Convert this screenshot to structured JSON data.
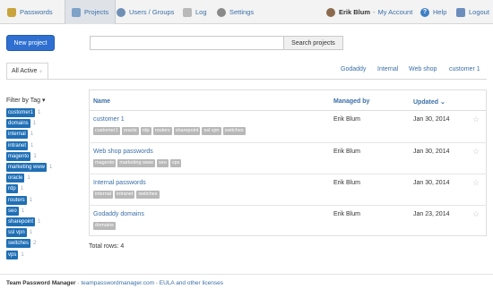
{
  "nav": {
    "passwords": "Passwords",
    "projects": "Projects",
    "users_groups": "Users / Groups",
    "log": "Log",
    "settings": "Settings",
    "user_name": "Erik Blum",
    "separator": "-",
    "my_account": "My Account",
    "help": "Help",
    "logout": "Logout",
    "help_icon_glyph": "?"
  },
  "actions": {
    "new_project": "New project",
    "search_placeholder": "",
    "search_button": "Search projects"
  },
  "filter": {
    "active_tab": "All Active",
    "active_tab_caret": "⬨",
    "quick_tags": [
      "Godaddy",
      "Internal",
      "Web shop",
      "customer 1"
    ]
  },
  "sidebar": {
    "title": "Filter by Tag",
    "title_caret": "▾",
    "tags": [
      {
        "name": "customer1",
        "count": "1"
      },
      {
        "name": "domains",
        "count": "1"
      },
      {
        "name": "internal",
        "count": "1"
      },
      {
        "name": "intranet",
        "count": "1"
      },
      {
        "name": "magento",
        "count": "1"
      },
      {
        "name": "marketing www",
        "count": "1"
      },
      {
        "name": "oracle",
        "count": "1"
      },
      {
        "name": "rdp",
        "count": "1"
      },
      {
        "name": "routers",
        "count": "1"
      },
      {
        "name": "seo",
        "count": "1"
      },
      {
        "name": "sharepoint",
        "count": "1"
      },
      {
        "name": "ssl vpn",
        "count": "1"
      },
      {
        "name": "switches",
        "count": "2"
      },
      {
        "name": "vps",
        "count": "1"
      }
    ]
  },
  "table": {
    "col_name": "Name",
    "col_managed": "Managed by",
    "col_updated": "Updated",
    "col_updated_sort": "⌄",
    "star_glyph": "☆",
    "rows": [
      {
        "name": "customer 1",
        "tags": [
          "customer1",
          "oracle",
          "rdp",
          "routers",
          "sharepoint",
          "ssl vpn",
          "switches"
        ],
        "managed_by": "Erik Blum",
        "updated": "Jan 30, 2014"
      },
      {
        "name": "Web shop passwords",
        "tags": [
          "magento",
          "marketing www",
          "seo",
          "vps"
        ],
        "managed_by": "Erik Blum",
        "updated": "Jan 30, 2014"
      },
      {
        "name": "Internal passwords",
        "tags": [
          "internal",
          "intranet",
          "switches"
        ],
        "managed_by": "Erik Blum",
        "updated": "Jan 30, 2014"
      },
      {
        "name": "Godaddy domains",
        "tags": [
          "domains"
        ],
        "managed_by": "Erik Blum",
        "updated": "Jan 23, 2014"
      }
    ],
    "total": "Total rows: 4"
  },
  "footer": {
    "brand": "Team Password Manager",
    "sep1": " - ",
    "site": "teampasswordmanager.com",
    "sep2": " - ",
    "eula": "EULA and other licenses"
  },
  "colors": {
    "accent": "#2e6fd1",
    "link": "#3a6fa8",
    "tag_blue": "#1f6fb5",
    "tag_gray": "#b8b8b8"
  },
  "icons": {
    "passwords": "lock-icon",
    "projects": "folder-icon",
    "users": "users-icon",
    "log": "log-icon",
    "settings": "gear-icon",
    "account": "person-icon",
    "help": "help-icon",
    "logout": "logout-icon"
  }
}
